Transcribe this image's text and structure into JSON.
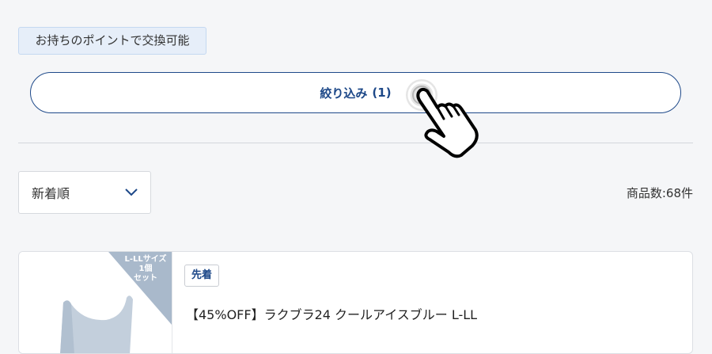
{
  "points_chip": {
    "label": "お持ちのポイントで交換可能"
  },
  "filter_button": {
    "label": "絞り込み",
    "count": "(1)"
  },
  "sort": {
    "selected": "新着順",
    "icon": "chevron-down-icon"
  },
  "results": {
    "count_text": "商品数:68件"
  },
  "product": {
    "corner_lines": [
      "L-LLサイズ",
      "1個",
      "セット"
    ],
    "badge": "先着",
    "title": "【45%OFF】ラクブラ24 クールアイスブルー L-LL"
  },
  "colors": {
    "accent": "#1d4888",
    "page_background": "#f5f6f8",
    "chip_background": "#e6eef9",
    "corner_ribbon": "#a9b9cb"
  },
  "icons": {
    "pointer": "pointing-hand-icon"
  }
}
